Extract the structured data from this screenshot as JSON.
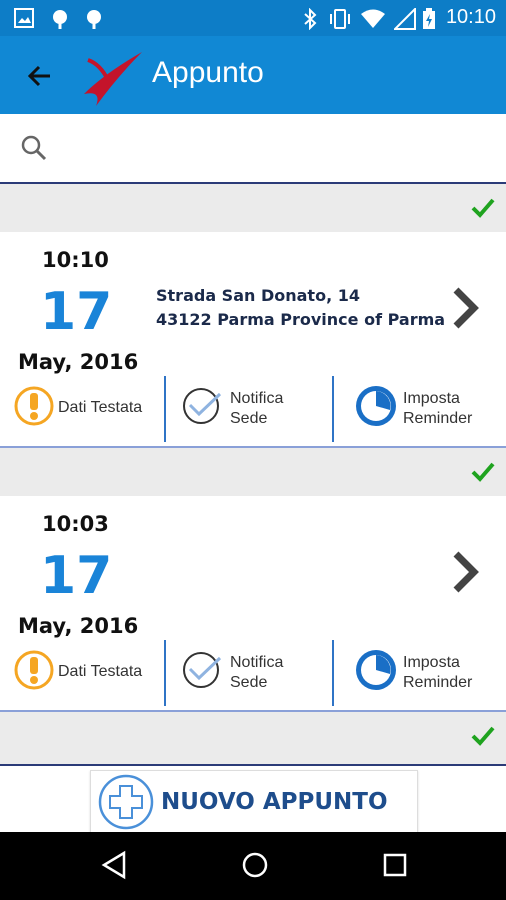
{
  "status_bar": {
    "time": "10:10",
    "left_icons": [
      "image-icon",
      "android-icon",
      "android-icon"
    ],
    "right_icons": [
      "bluetooth-icon",
      "vibrate-icon",
      "wifi-icon",
      "signal-icon",
      "battery-charging-icon"
    ]
  },
  "app_bar": {
    "title": "Appunto",
    "color": "#1188d4"
  },
  "search": {
    "value": "",
    "placeholder": ""
  },
  "appointments": [
    {
      "time": "10:10",
      "day": "17",
      "month": "May, 2016",
      "address_line1": "Strada San Donato, 14",
      "address_line2": "43122 Parma Province of Parma",
      "actions": [
        {
          "label": "Dati Testata",
          "icon": "warning-icon"
        },
        {
          "label_1": "Notifica",
          "label_2": "Sede",
          "icon": "check-circle-icon"
        },
        {
          "label_1": "Imposta",
          "label_2": "Reminder",
          "icon": "clock-icon"
        }
      ]
    },
    {
      "time": "10:03",
      "day": "17",
      "month": "May, 2016",
      "address_line1": "",
      "address_line2": "",
      "actions": [
        {
          "label": "Dati Testata",
          "icon": "warning-icon"
        },
        {
          "label_1": "Notifica",
          "label_2": "Sede",
          "icon": "check-circle-icon"
        },
        {
          "label_1": "Imposta",
          "label_2": "Reminder",
          "icon": "clock-icon"
        }
      ]
    }
  ],
  "bottom": {
    "new_button_label": "NUOVO APPUNTO"
  },
  "colors": {
    "accent": "#1a84d8",
    "check": "#1fa31f",
    "warning": "#f5a623",
    "divider": "#2f74c6"
  }
}
